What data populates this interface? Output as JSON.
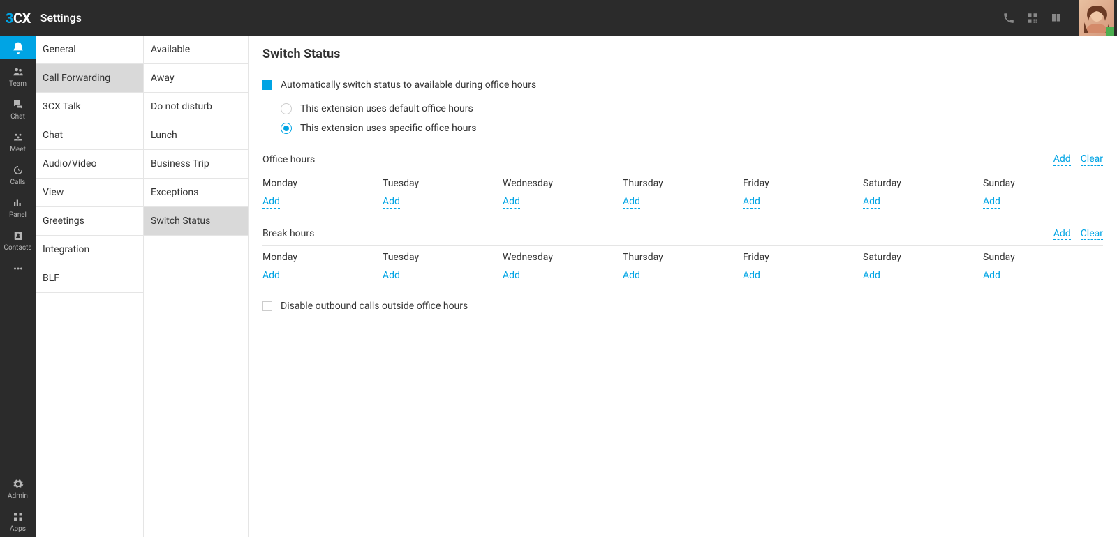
{
  "header": {
    "logo": {
      "three": "3",
      "cx": "CX"
    },
    "title": "Settings"
  },
  "rail": {
    "items": [
      {
        "name": "notifications",
        "label": "",
        "active": true
      },
      {
        "name": "team",
        "label": "Team"
      },
      {
        "name": "chat",
        "label": "Chat"
      },
      {
        "name": "meet",
        "label": "Meet"
      },
      {
        "name": "calls",
        "label": "Calls"
      },
      {
        "name": "panel",
        "label": "Panel"
      },
      {
        "name": "contacts",
        "label": "Contacts"
      },
      {
        "name": "more",
        "label": ""
      }
    ],
    "bottom": [
      {
        "name": "admin",
        "label": "Admin"
      },
      {
        "name": "apps",
        "label": "Apps"
      }
    ]
  },
  "settings_nav": {
    "items": [
      {
        "label": "General"
      },
      {
        "label": "Call Forwarding",
        "active": true
      },
      {
        "label": "3CX Talk"
      },
      {
        "label": "Chat"
      },
      {
        "label": "Audio/Video"
      },
      {
        "label": "View"
      },
      {
        "label": "Greetings"
      },
      {
        "label": "Integration"
      },
      {
        "label": "BLF"
      }
    ]
  },
  "status_nav": {
    "items": [
      {
        "label": "Available"
      },
      {
        "label": "Away"
      },
      {
        "label": "Do not disturb"
      },
      {
        "label": "Lunch"
      },
      {
        "label": "Business Trip"
      },
      {
        "label": "Exceptions"
      },
      {
        "label": "Switch Status",
        "active": true
      }
    ]
  },
  "main": {
    "heading": "Switch Status",
    "auto_switch": {
      "label": "Automatically switch status to available during office hours",
      "checked": true
    },
    "radios": {
      "default_hours": "This extension uses default office hours",
      "specific_hours": "This extension uses specific office hours",
      "selected": "specific"
    },
    "office_section": {
      "title": "Office hours",
      "add": "Add",
      "clear": "Clear"
    },
    "break_section": {
      "title": "Break hours",
      "add": "Add",
      "clear": "Clear"
    },
    "days": [
      "Monday",
      "Tuesday",
      "Wednesday",
      "Thursday",
      "Friday",
      "Saturday",
      "Sunday"
    ],
    "add_label": "Add",
    "disable_outbound": {
      "label": "Disable outbound calls outside office hours",
      "checked": false
    }
  }
}
